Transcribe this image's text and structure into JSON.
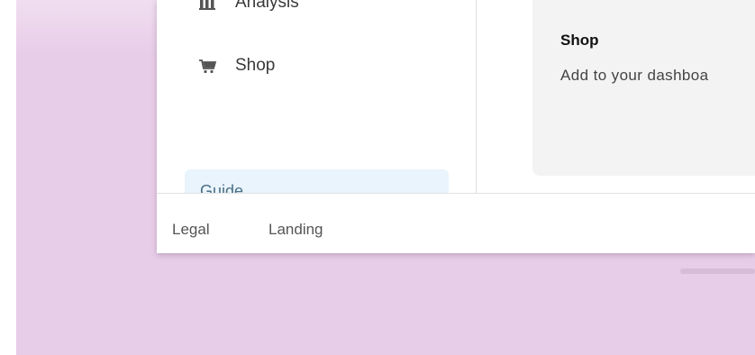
{
  "sidebar": {
    "items": [
      {
        "label": "Analysis",
        "icon": "bar-chart-icon"
      },
      {
        "label": "Shop",
        "icon": "cart-icon"
      }
    ],
    "guide_label": "Guide"
  },
  "main": {
    "shop_card": {
      "title": "Shop",
      "description": "Add to your dashboa"
    }
  },
  "footer": {
    "links": [
      "Legal",
      "Landing"
    ]
  },
  "colors": {
    "backdrop": "#e8cde8",
    "guide_card": "#e9f4fc",
    "card": "#f3f3f3"
  }
}
